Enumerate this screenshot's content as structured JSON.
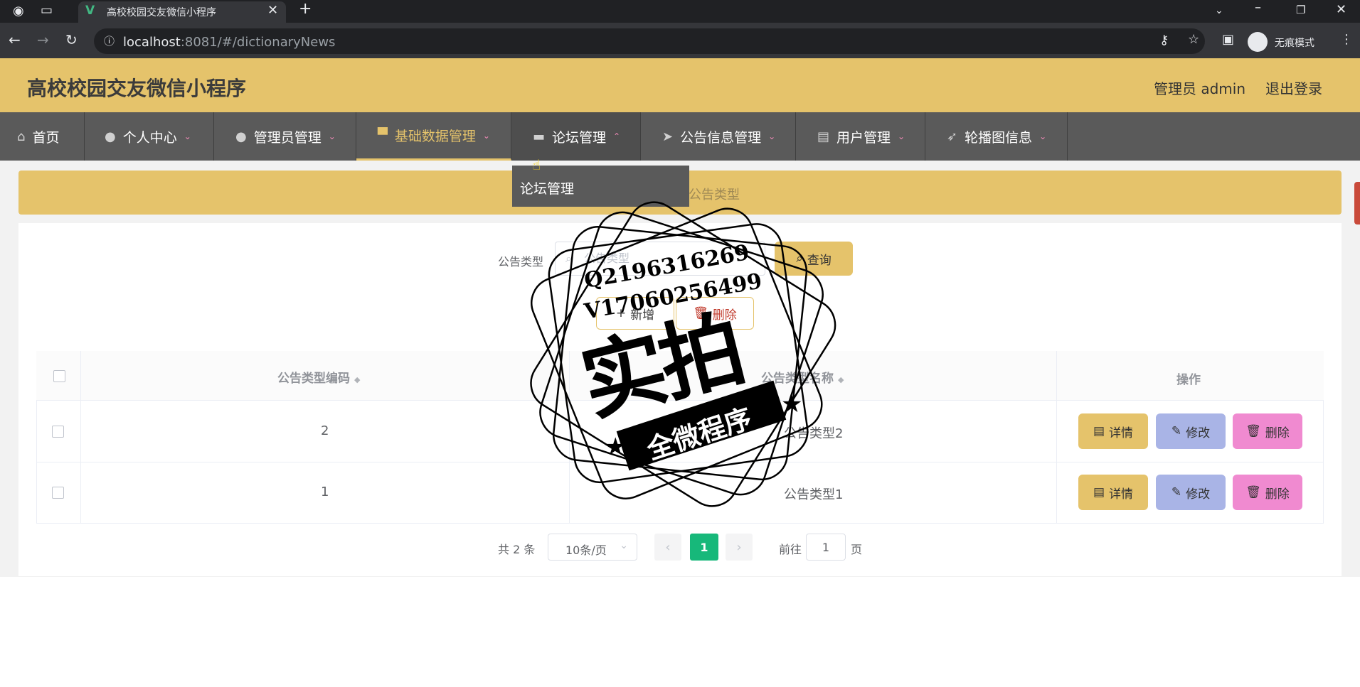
{
  "browser": {
    "tab_title": "高校校园交友微信小程序",
    "url_host": "localhost",
    "url_rest": ":8081/#/dictionaryNews",
    "incognito_label": "无痕模式"
  },
  "header": {
    "title": "高校校园交友微信小程序",
    "user_label": "管理员 admin",
    "logout_label": "退出登录"
  },
  "nav": {
    "items": [
      {
        "label": "首页",
        "icon": "home-icon"
      },
      {
        "label": "个人中心",
        "icon": "user-icon"
      },
      {
        "label": "管理员管理",
        "icon": "user-icon"
      },
      {
        "label": "基础数据管理",
        "icon": "brush-icon"
      },
      {
        "label": "论坛管理",
        "icon": "briefcase-icon"
      },
      {
        "label": "公告信息管理",
        "icon": "send-icon"
      },
      {
        "label": "用户管理",
        "icon": "clipboard-icon"
      },
      {
        "label": "轮播图信息",
        "icon": "navigation-icon"
      }
    ],
    "dropdown_item": "论坛管理"
  },
  "breadcrumb": {
    "text": "公告类型"
  },
  "search": {
    "label": "公告类型",
    "placeholder": "公告类型",
    "query_label": "查询"
  },
  "actions": {
    "add_label": "新增",
    "delete_label": "删除"
  },
  "table": {
    "headers": {
      "code": "公告类型编码",
      "name": "公告类型名称",
      "ops": "操作"
    },
    "rows": [
      {
        "code": "2",
        "name": "公告类型2"
      },
      {
        "code": "1",
        "name": "公告类型1"
      }
    ],
    "row_buttons": {
      "detail": "详情",
      "edit": "修改",
      "delete": "删除"
    }
  },
  "pagination": {
    "total": "共 2 条",
    "page_size": "10条/页",
    "current_page": "1",
    "goto_label": "前往",
    "goto_value": "1",
    "page_label": "页"
  },
  "watermark": {
    "line1": "Q2196316269",
    "line2": "V17060256499",
    "big": "实拍",
    "band": "全微程序"
  },
  "colors": {
    "accent": "#e5c36b",
    "nav_bg": "#5a5a5a",
    "page_current": "#17b87a",
    "edit_btn": "#a9b4e6",
    "delete_btn": "#f08ad0"
  }
}
